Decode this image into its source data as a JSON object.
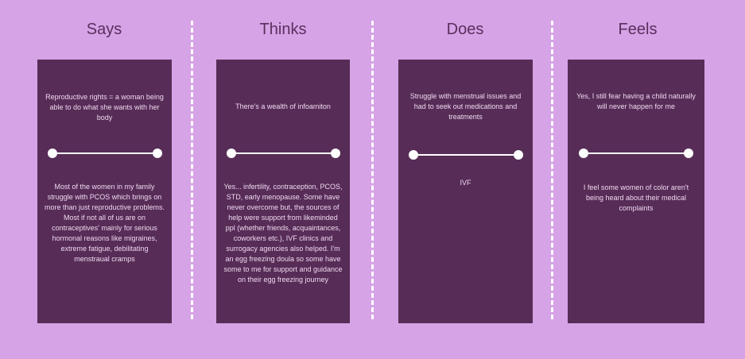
{
  "columns": [
    {
      "title": "Says",
      "top_text": "Reproductive rights = a woman being able to do what she wants with her body",
      "bottom_text": "Most of the women in my family struggle with PCOS which brings on more than just reproductive problems. Most if not all of us are on contraceptives' mainly for serious hormonal reasons like migraines, extreme fatigue, debilitating menstraual cramps"
    },
    {
      "title": "Thinks",
      "top_text": "There's a wealth of infoamiton",
      "bottom_text": "Yes... infertility, contraception, PCOS, STD, early menopause. Some have never overcome but, the sources of help were support from likeminded ppl (whether friends, acquaintances, coworkers etc.), IVF clinics and surrogacy agencies also helped. I'm an egg freezing doula so some have some to me for support and guidance on their egg freezing journey"
    },
    {
      "title": "Does",
      "top_text": "Struggle with menstrual issues and had to seek out medications and treatments",
      "bottom_text": "IVF"
    },
    {
      "title": "Feels",
      "top_text": "Yes, I still fear having a child naturally will never happen for me",
      "bottom_text": "I feel some women of color aren't being heard about their medical complaints"
    }
  ],
  "colors": {
    "background": "#d6a3e6",
    "card": "#572d57",
    "title": "#5a2f5e",
    "slider": "#ffffff"
  }
}
